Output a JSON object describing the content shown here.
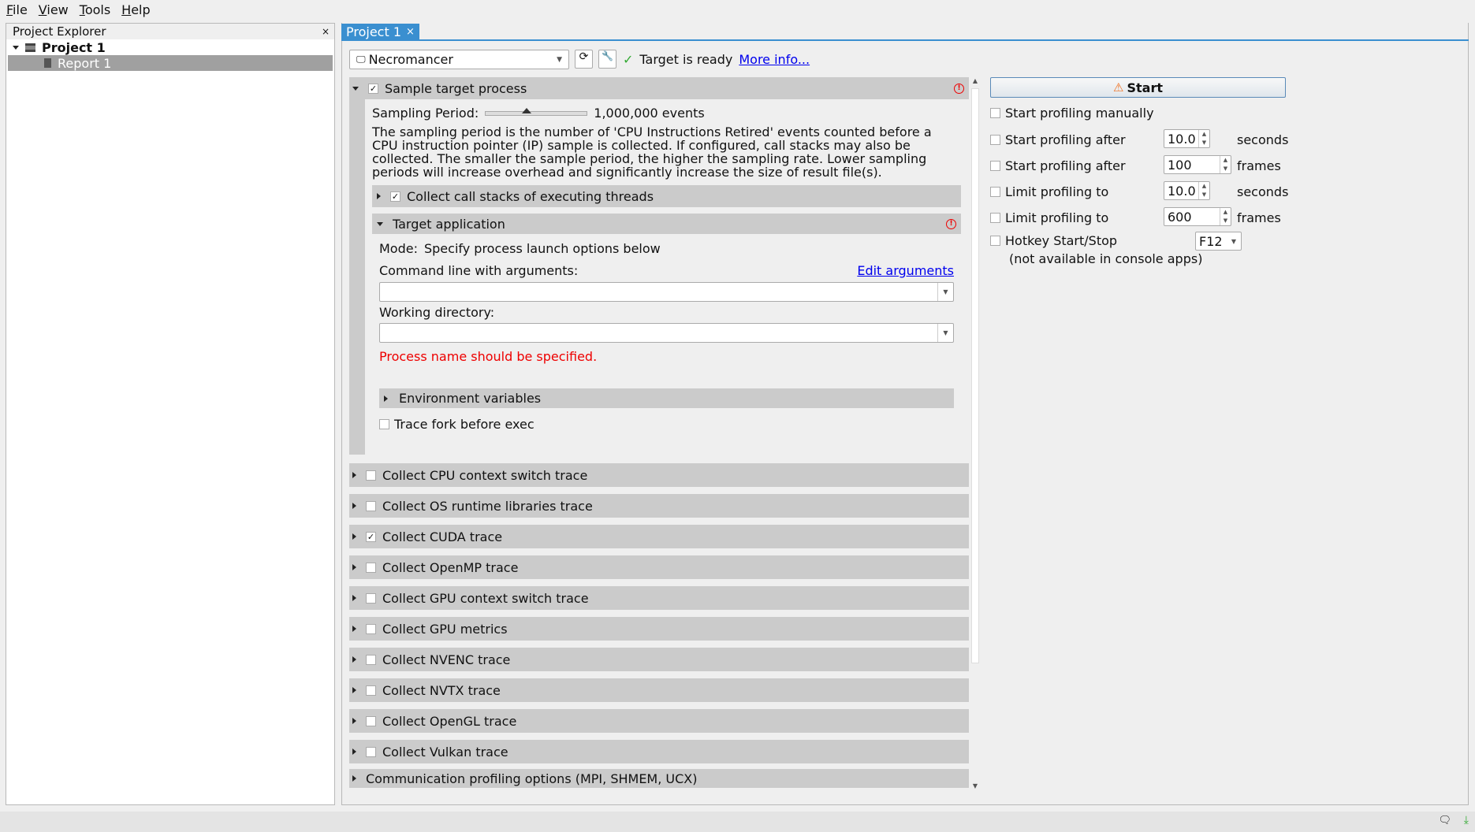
{
  "menu": [
    "File",
    "View",
    "Tools",
    "Help"
  ],
  "explorer": {
    "title": "Project Explorer",
    "close": "×",
    "project": "Project 1",
    "report": "Report 1"
  },
  "tab": {
    "label": "Project 1",
    "close": "×"
  },
  "toolbar": {
    "target": "Necromancer",
    "status": "Target is ready",
    "more_info": "More info..."
  },
  "sample": {
    "label": "Sample target process",
    "checked": true,
    "period_label": "Sampling Period:",
    "period_value": "1,000,000 events",
    "slider_fraction": 0.4,
    "description": "The sampling period is the number of 'CPU Instructions Retired' events counted before a CPU instruction pointer (IP) sample is collected. If configured, call stacks may also be collected. The smaller the sample period, the higher the sampling rate. Lower sampling periods will increase overhead and significantly increase the size of result file(s).",
    "call_stacks": "Collect call stacks of executing threads",
    "target_app": "Target application",
    "mode_label": "Mode:",
    "mode_value": "Specify process launch options below",
    "cmd_label": "Command line with arguments:",
    "edit_args": "Edit arguments",
    "cmd_value": "",
    "wd_label": "Working directory:",
    "wd_value": "",
    "error": "Process name should be specified.",
    "env": "Environment variables",
    "trace_fork": "Trace fork before exec"
  },
  "sections": [
    {
      "label": "Collect CPU context switch trace",
      "checked": false
    },
    {
      "label": "Collect OS runtime libraries trace",
      "checked": false
    },
    {
      "label": "Collect CUDA trace",
      "checked": true
    },
    {
      "label": "Collect OpenMP trace",
      "checked": false
    },
    {
      "label": "Collect GPU context switch trace",
      "checked": false
    },
    {
      "label": "Collect GPU metrics",
      "checked": false
    },
    {
      "label": "Collect NVENC trace",
      "checked": false
    },
    {
      "label": "Collect NVTX trace",
      "checked": false
    },
    {
      "label": "Collect OpenGL trace",
      "checked": false
    },
    {
      "label": "Collect Vulkan trace",
      "checked": false
    }
  ],
  "comm": "Communication profiling options (MPI, SHMEM, UCX)",
  "right": {
    "start": "Start",
    "manual": "Start profiling manually",
    "rows": [
      {
        "label": "Start profiling after",
        "value": "10.0",
        "unit": "seconds"
      },
      {
        "label": "Start profiling after",
        "value": "100",
        "unit": "frames"
      },
      {
        "label": "Limit profiling to",
        "value": "10.0",
        "unit": "seconds"
      },
      {
        "label": "Limit profiling to",
        "value": "600",
        "unit": "frames"
      }
    ],
    "hotkey": "Hotkey Start/Stop",
    "hotkey_value": "F12",
    "hotkey_note": "(not available in console apps)"
  },
  "colors": {
    "tab": "#3a8fd0",
    "error": "#e00000",
    "link": "#0000ee",
    "selection": "#a0a0a0"
  }
}
